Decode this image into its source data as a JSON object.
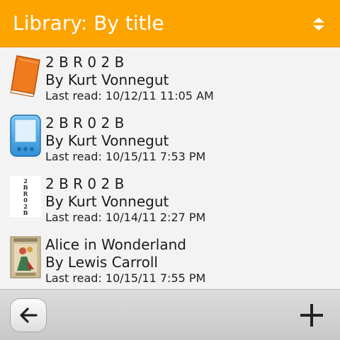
{
  "header": {
    "title": "Library: By title",
    "background": "#fda400",
    "sort_icon": "sort-up-down-icon"
  },
  "books": [
    {
      "title": "2 B R 0 2 B",
      "author": "By Kurt Vonnegut",
      "last_read": "Last read: 10/12/11 11:05 AM",
      "cover_icon": "orange-book-icon"
    },
    {
      "title": "2 B R 0 2 B",
      "author": "By Kurt Vonnegut",
      "last_read": "Last read: 10/15/11 7:53 PM",
      "cover_icon": "ebook-reader-icon"
    },
    {
      "title": "2 B R 0 2 B",
      "author": "By Kurt Vonnegut",
      "last_read": "Last read: 10/14/11 2:27 PM",
      "cover_icon": "text-cover-image",
      "cover_text": [
        "2",
        "B",
        "R",
        "0",
        "2",
        "B"
      ]
    },
    {
      "title": "Alice in Wonderland",
      "author": "By Lewis Carroll",
      "last_read": "Last read: 10/15/11 7:55 PM",
      "cover_icon": "illustrated-cover-image"
    }
  ],
  "toolbar": {
    "back_icon": "back-arrow-icon",
    "add_icon": "plus-icon"
  }
}
